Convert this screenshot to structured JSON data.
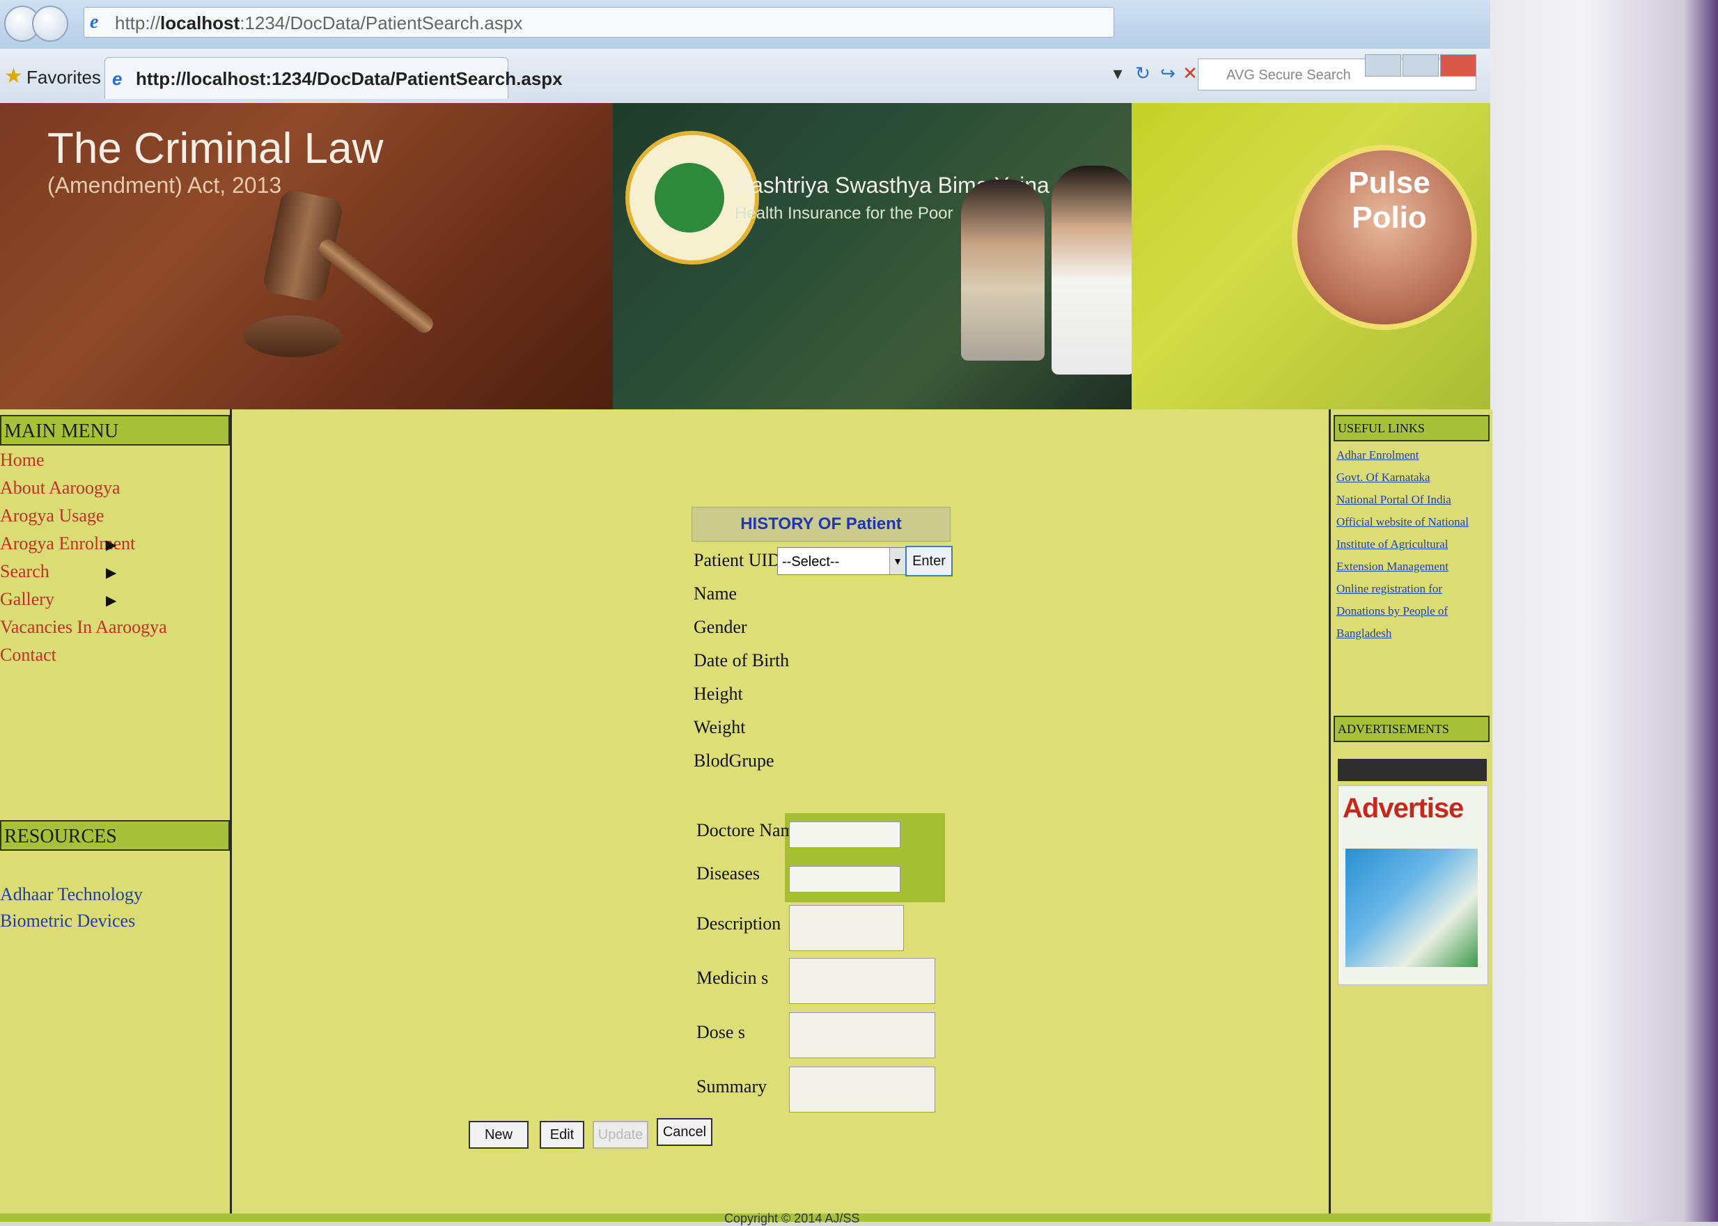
{
  "browser": {
    "url_prefix": "http://",
    "url_host": "localhost",
    "url_path": ":1234/DocData/PatientSearch.aspx",
    "favorites_label": "Favorites",
    "tab_title": "http://localhost:1234/DocData/PatientSearch.aspx",
    "search_placeholder": "AVG Secure Search"
  },
  "banner": {
    "title": "The Criminal Law",
    "subtitle": "(Amendment) Act, 2013",
    "scheme_title": "Rashtriya Swasthya Bima Yojna",
    "scheme_subtitle": "Health Insurance for the Poor",
    "polio_text": "Pulse Polio"
  },
  "left_menu": {
    "header": "MAIN MENU",
    "items": [
      "Home",
      "About Aaroogya",
      "Arogya Usage",
      "Arogya Enrolment",
      "Search",
      "Gallery",
      "Vacancies In Aaroogya",
      "Contact"
    ],
    "submenu_arrow": "▶",
    "resources_header": "RESOURCES",
    "resources": [
      "Adhaar Technology",
      "Biometric Devices"
    ]
  },
  "form": {
    "heading": "HISTORY OF Patient",
    "uid_label": "Patient UIDAI",
    "uid_select_value": "--Select--",
    "enter_label": "Enter",
    "name_label": "Name",
    "gender_label": "Gender",
    "dob_label": "Date of Birth",
    "height_label": "Height",
    "weight_label": "Weight",
    "blood_label": "BlodGrupe",
    "doctor_label": "Doctore Name",
    "disease_label": "Diseases",
    "description_label": "Description",
    "medicine_label": "Medicin s",
    "dose_label": "Dose s",
    "summary_label": "Summary",
    "buttons": {
      "new": "New",
      "edit": "Edit",
      "update": "Update",
      "cancel": "Cancel"
    }
  },
  "right_col": {
    "links_header": "USEFUL LINKS",
    "links": [
      "Adhar Enrolment",
      "Govt. Of Karnataka",
      "National Portal Of India",
      "Official website of National",
      "Institute of Agricultural",
      "Extension Management",
      "Online registration for",
      "Donations by People of",
      "Bangladesh"
    ],
    "ads_header": "ADVERTISEMENTS",
    "ad_title": "Advertise"
  },
  "footer": {
    "copyright": "Copyright © 2014 AJ/SS"
  },
  "colors": {
    "page_bg": "#dede76",
    "panel_header": "#a9c13a",
    "menu_link": "#c2302a",
    "resource_link": "#1f3ea7",
    "form_heading": "#2233b8"
  }
}
